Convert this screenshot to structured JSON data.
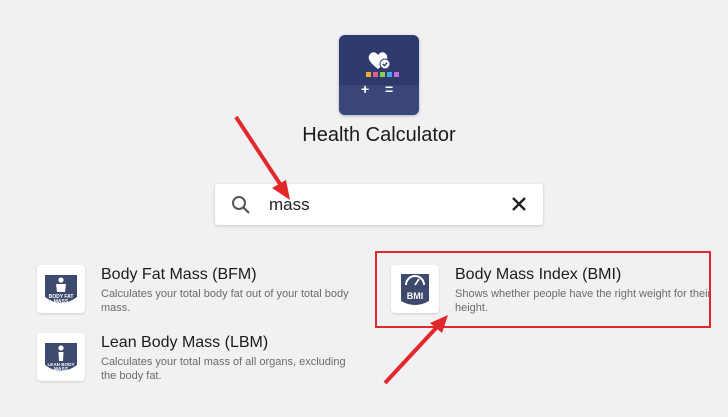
{
  "app": {
    "title": "Health Calculator"
  },
  "search": {
    "value": "mass",
    "placeholder": ""
  },
  "results": [
    {
      "title": "Body Fat Mass (BFM)",
      "description": "Calculates your total body fat out of your total body mass.",
      "icon": "body-fat-mass-icon",
      "icon_label": "BODY FAT MASS"
    },
    {
      "title": "Lean Body Mass (LBM)",
      "description": "Calculates your total mass of all organs, excluding the body fat.",
      "icon": "lean-body-mass-icon",
      "icon_label": "LEAN BODY MASS"
    },
    {
      "title": "Body Mass Index (BMI)",
      "description": "Shows whether people have the right weight for their height.",
      "icon": "bmi-scale-icon",
      "icon_label": "BMI"
    }
  ],
  "colors": {
    "icon_bg": "#2e3a6b",
    "icon_fg": "#3d4a6e",
    "annotation_red": "#e2282b",
    "page_bg": "#f1f1f3"
  }
}
